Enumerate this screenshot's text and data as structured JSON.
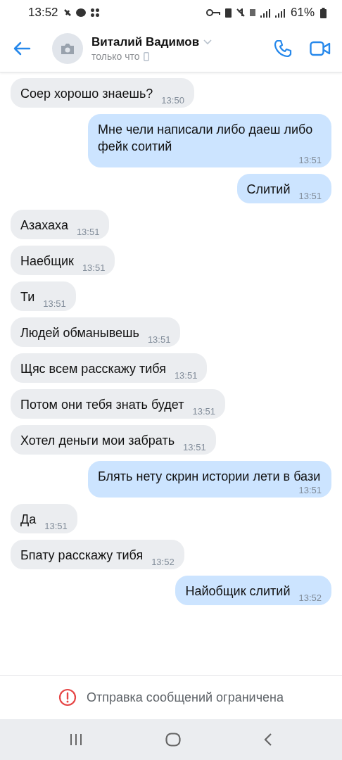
{
  "status_bar": {
    "time": "13:52",
    "battery": "61%"
  },
  "header": {
    "name": "Виталий Вадимов",
    "status": "только что"
  },
  "messages": [
    {
      "text": "Соер хорошо знаешь?",
      "time": "13:50",
      "kind": "incoming"
    },
    {
      "text": "Мне чели написали либо даеш либо фейк соитий",
      "time": "13:51",
      "kind": "outgoing"
    },
    {
      "text": "Слитий",
      "time": "13:51",
      "kind": "outgoing"
    },
    {
      "text": "Азахаха",
      "time": "13:51",
      "kind": "incoming"
    },
    {
      "text": "Наебщик",
      "time": "13:51",
      "kind": "incoming"
    },
    {
      "text": "Ти",
      "time": "13:51",
      "kind": "incoming"
    },
    {
      "text": "Людей обманывешь",
      "time": "13:51",
      "kind": "incoming"
    },
    {
      "text": "Щяс всем расскажу тибя",
      "time": "13:51",
      "kind": "incoming"
    },
    {
      "text": "Потом они тебя знать будет",
      "time": "13:51",
      "kind": "incoming"
    },
    {
      "text": "Хотел деньги мои забрать",
      "time": "13:51",
      "kind": "incoming"
    },
    {
      "text": "Блять нету скрин истории лети в бази",
      "time": "13:51",
      "kind": "outgoing"
    },
    {
      "text": "Да",
      "time": "13:51",
      "kind": "incoming"
    },
    {
      "text": "Бпату расскажу тибя",
      "time": "13:52",
      "kind": "incoming"
    },
    {
      "text": "Найобщик слитий",
      "time": "13:52",
      "kind": "outgoing"
    }
  ],
  "notice": "Отправка сообщений ограничена"
}
